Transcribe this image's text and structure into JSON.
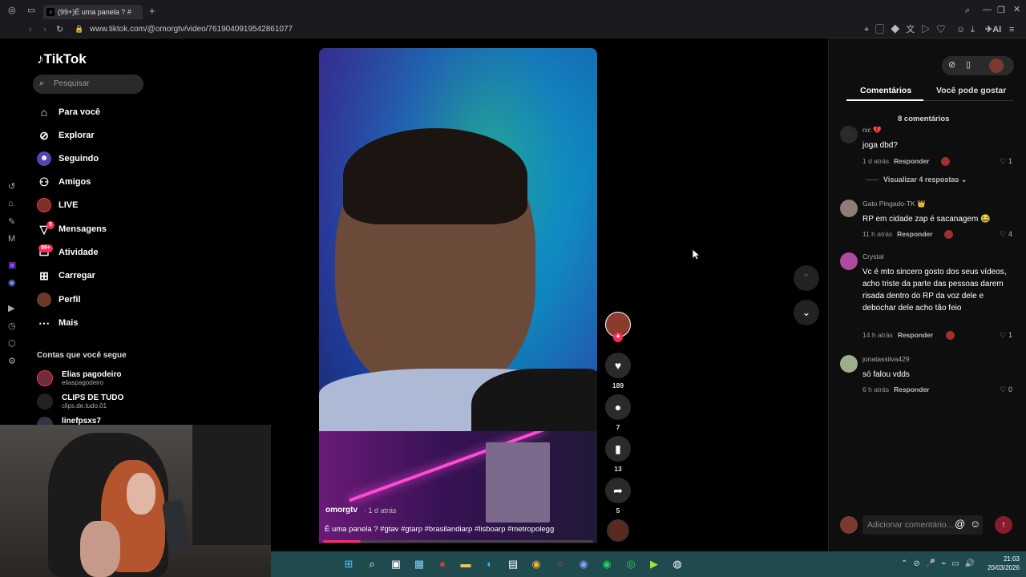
{
  "browser": {
    "tab_title": "(99+)É uma panela ? #",
    "new_tab": "+",
    "url": "www.tiktok.com/@omorgtv/video/7619040919542861077",
    "ai_label": "AI"
  },
  "sidebar": {
    "logo": "TikTok",
    "search_placeholder": "Pesquisar",
    "nav": [
      {
        "label": "Para você",
        "icon": "home-icon"
      },
      {
        "label": "Explorar",
        "icon": "compass-icon"
      },
      {
        "label": "Seguindo",
        "icon": "following-icon"
      },
      {
        "label": "Amigos",
        "icon": "friends-icon"
      },
      {
        "label": "LIVE",
        "icon": "live-icon"
      },
      {
        "label": "Mensagens",
        "icon": "messages-icon",
        "badge": "5"
      },
      {
        "label": "Atividade",
        "icon": "activity-icon",
        "badge": "99+"
      },
      {
        "label": "Carregar",
        "icon": "upload-icon"
      },
      {
        "label": "Perfil",
        "icon": "profile-icon"
      },
      {
        "label": "Mais",
        "icon": "more-icon"
      }
    ],
    "following_title": "Contas que você segue",
    "following": [
      {
        "name": "Elias pagodeiro",
        "handle": "eliaspagodeiro"
      },
      {
        "name": "CLIPS DE TUDO",
        "handle": "clips.de.tudo.01"
      },
      {
        "name": "linefpsxs7",
        "handle": ""
      }
    ]
  },
  "video": {
    "author": "omorgtv",
    "time": "· 1 d atrás",
    "caption": "É uma panela ? #gtav #gtarp #brasilandiarp #lisboarp #metropolegg",
    "progress": 0.14,
    "likes": "189",
    "comments": "7",
    "saves": "13",
    "shares": "5"
  },
  "panel": {
    "tab_comments": "Comentários",
    "tab_suggested": "Você pode gostar",
    "count": "8 comentários",
    "reply_label": "Responder",
    "view_replies": "Visualizar 4 respostas ⌄",
    "comments": [
      {
        "user": "nic 💔",
        "text": "joga dbd?",
        "time": "1 d atrás",
        "likes": "1"
      },
      {
        "user": "Gato Pingado-TK 👑",
        "text": "RP em cidade zap é sacanagem 😂",
        "time": "11 h atrás",
        "likes": "4"
      },
      {
        "user": "Crystal",
        "text": "Vc é mto sincero gosto dos seus vídeos, acho triste da parte das pessoas darem risada dentro do RP da voz dele e debochar dele acho tão feio",
        "time": "14 h atrás",
        "likes": "1"
      },
      {
        "user": "jonatassilva429",
        "text": "só falou vdds",
        "time": "6 h atrás",
        "likes": "0"
      }
    ],
    "add_comment_placeholder": "Adicionar comentário..."
  },
  "clock": {
    "time": "21:03",
    "date": "20/03/2026"
  },
  "colors": {
    "accent": "#fe2c55",
    "taskbar": "#1f4a4e"
  }
}
